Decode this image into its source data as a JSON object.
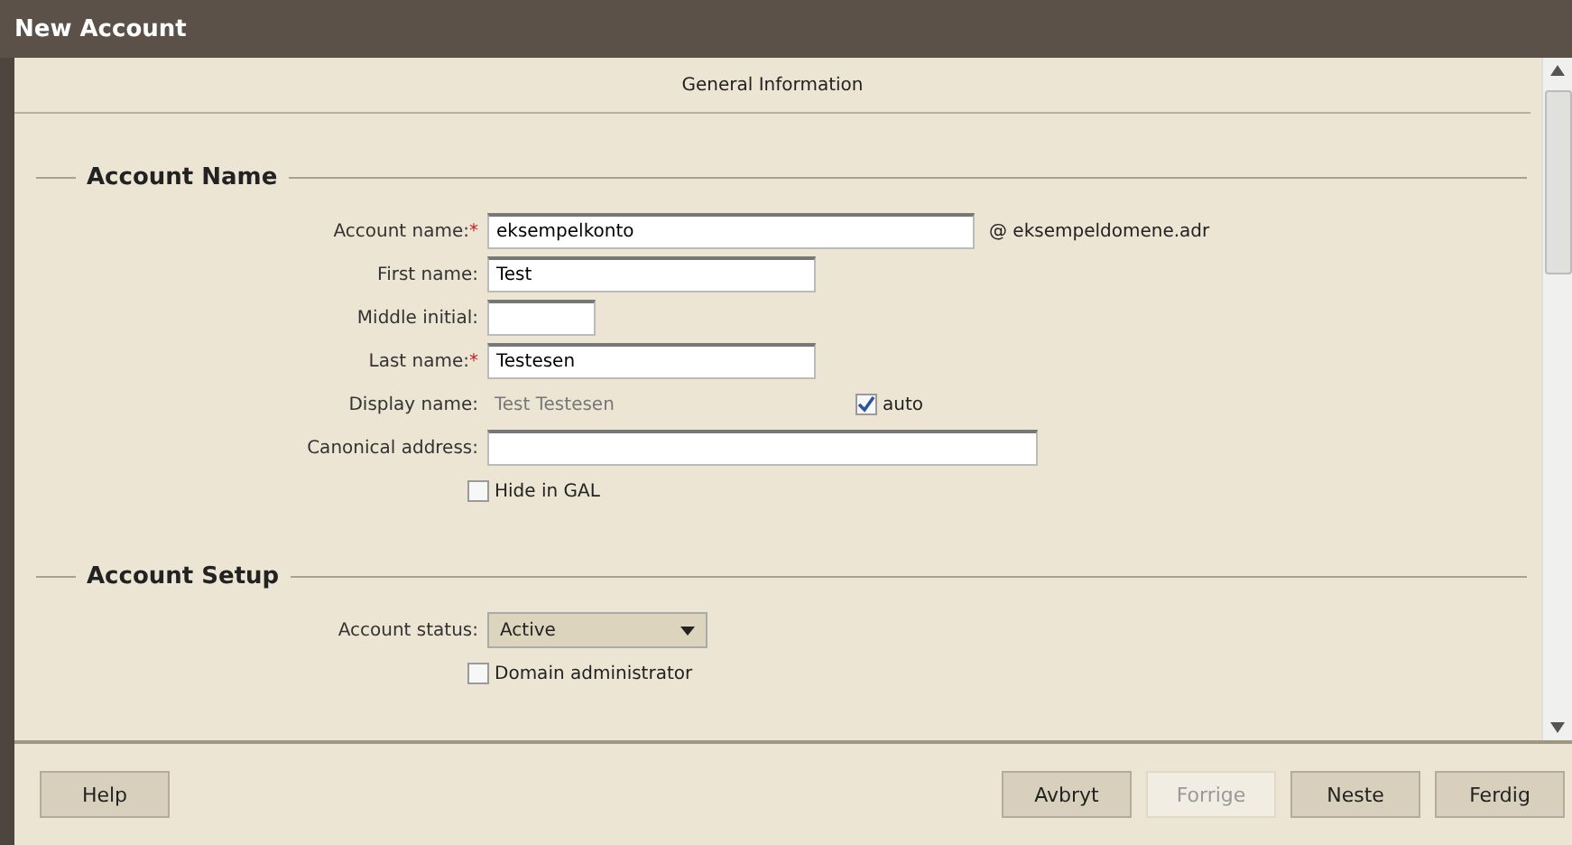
{
  "window": {
    "title": "New Account"
  },
  "page_header": "General Information",
  "sections": [
    {
      "title": "Account Name",
      "fields": [
        {
          "kind": "input",
          "label": "Account name:",
          "mark": "*",
          "value": "eksempelkonto",
          "suffix": "@ eksempeldomene.adr"
        },
        {
          "kind": "input",
          "label": "First name:",
          "value": "Test"
        },
        {
          "kind": "input",
          "label": "Middle initial:"
        },
        {
          "kind": "input",
          "label": "Last name:",
          "mark": "*",
          "value": "Testesen"
        },
        {
          "kind": "display",
          "label": "Display name:",
          "value": "Test Testesen",
          "option": {
            "label": "auto",
            "checked": true
          }
        },
        {
          "kind": "input",
          "label": "Canonical address:"
        },
        {
          "kind": "checkbox",
          "label": "Hide in GAL",
          "checked": false
        }
      ]
    },
    {
      "title": "Account Setup",
      "fields": [
        {
          "kind": "select",
          "label": "Account status:",
          "value": "Active"
        },
        {
          "kind": "checkbox",
          "label": "Domain administrator",
          "checked": false
        }
      ]
    }
  ],
  "buttons_left": [
    {
      "label": "Help",
      "disabled": false
    }
  ],
  "buttons_right": [
    {
      "label": "Avbryt",
      "disabled": false
    },
    {
      "label": "Forrige",
      "disabled": true
    },
    {
      "label": "Neste",
      "disabled": false
    },
    {
      "label": "Ferdig",
      "disabled": false
    }
  ]
}
